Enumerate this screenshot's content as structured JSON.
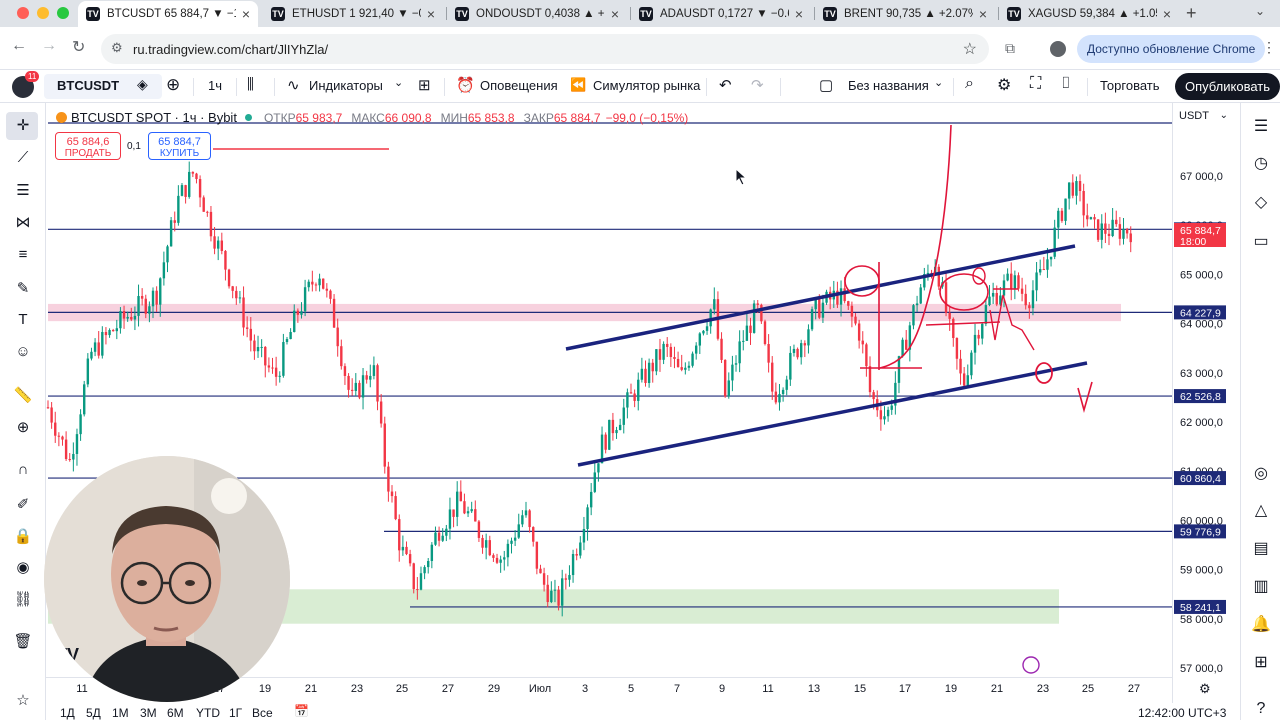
{
  "browser": {
    "tabs": [
      {
        "title": "BTCUSDT 65 884,7 ▼ −1,0…",
        "active": true
      },
      {
        "title": "ETHUSDT 1 921,40 ▼ −0.4…",
        "active": false
      },
      {
        "title": "ONDOUSDT 0,4038 ▲ +0…",
        "active": false
      },
      {
        "title": "ADAUSDT 0,1727 ▼ −0.6…",
        "active": false
      },
      {
        "title": "BRENT 90,735 ▲ +2.07%…",
        "active": false
      },
      {
        "title": "XAGUSD 59,384 ▲ +1.05…",
        "active": false
      }
    ],
    "url": "ru.tradingview.com/chart/JlIYhZla/",
    "update_label": "Доступно обновление Chrome"
  },
  "toolbar": {
    "notifications": "11",
    "symbol": "BTCUSDT",
    "interval": "1ч",
    "indicators": "Индикаторы",
    "alerts": "Оповещения",
    "replay": "Симулятор рынка",
    "layout_name": "Без названия",
    "trade": "Торговать",
    "publish": "Опубликовать"
  },
  "legend": {
    "title": "BTCUSDT SPOT · 1ч · Bybit",
    "open_label": "ОТКР",
    "open": "65 983,7",
    "high_label": "МАКС",
    "high": "66 090,8",
    "low_label": "МИН",
    "low": "65 853,8",
    "close_label": "ЗАКР",
    "close": "65 884,7",
    "change": "−99,0 (−0,15%)",
    "sell_price": "65 884,6",
    "sell_label": "ПРОДАТЬ",
    "spread": "0,1",
    "buy_price": "65 884,7",
    "buy_label": "КУПИТЬ"
  },
  "price_scale": {
    "currency": "USDT",
    "ticks": [
      "67 000,0",
      "66 000,0",
      "65 000,0",
      "64 000,0",
      "63 000,0",
      "62 000,0",
      "61 000,0",
      "60 000,0",
      "59 000,0",
      "58 000,0",
      "57 000,0"
    ],
    "badges": [
      {
        "value": "65 916,3",
        "color": "#1e2a78"
      },
      {
        "value": "65 884,7",
        "sub": "18:00",
        "color": "#f23645"
      },
      {
        "value": "64 227,9",
        "color": "#1e2a78"
      },
      {
        "value": "62 526,8",
        "color": "#1e2a78"
      },
      {
        "value": "60 860,4",
        "color": "#1e2a78"
      },
      {
        "value": "59 776,9",
        "color": "#1e2a78"
      },
      {
        "value": "58 241,1",
        "color": "#1e2a78"
      }
    ]
  },
  "time_scale": {
    "labels": [
      "11",
      "17",
      "19",
      "21",
      "23",
      "25",
      "27",
      "29",
      "Июл",
      "3",
      "5",
      "7",
      "9",
      "11",
      "13",
      "15",
      "17",
      "19",
      "21",
      "23",
      "25",
      "27"
    ]
  },
  "bottom_bar": {
    "ranges": [
      "1Д",
      "5Д",
      "1М",
      "3М",
      "6М",
      "YTD",
      "1Г",
      "Все"
    ],
    "clock": "12:42:00 UTC+3"
  },
  "chart_data": {
    "type": "candlestick",
    "symbol": "BTCUSDT",
    "ylim": [
      56700,
      67400
    ],
    "horizontal_levels": [
      65916.3,
      64227.9,
      62526.8,
      60860.4,
      59776.9,
      58241.1
    ],
    "path_points": [
      [
        0,
        62300
      ],
      [
        0.02,
        61200
      ],
      [
        0.04,
        63400
      ],
      [
        0.07,
        64100
      ],
      [
        0.1,
        64600
      ],
      [
        0.12,
        66500
      ],
      [
        0.135,
        67100
      ],
      [
        0.15,
        66000
      ],
      [
        0.17,
        64800
      ],
      [
        0.19,
        63500
      ],
      [
        0.21,
        62900
      ],
      [
        0.23,
        64200
      ],
      [
        0.25,
        65100
      ],
      [
        0.265,
        64000
      ],
      [
        0.28,
        62400
      ],
      [
        0.3,
        63200
      ],
      [
        0.31,
        61300
      ],
      [
        0.325,
        59500
      ],
      [
        0.34,
        58600
      ],
      [
        0.36,
        59800
      ],
      [
        0.38,
        60400
      ],
      [
        0.4,
        59700
      ],
      [
        0.42,
        59200
      ],
      [
        0.44,
        60200
      ],
      [
        0.455,
        58800
      ],
      [
        0.47,
        58300
      ],
      [
        0.49,
        59600
      ],
      [
        0.51,
        61500
      ],
      [
        0.53,
        62200
      ],
      [
        0.55,
        62900
      ],
      [
        0.57,
        63500
      ],
      [
        0.585,
        62900
      ],
      [
        0.6,
        63800
      ],
      [
        0.615,
        64400
      ],
      [
        0.625,
        62500
      ],
      [
        0.64,
        63600
      ],
      [
        0.655,
        64300
      ],
      [
        0.67,
        62500
      ],
      [
        0.69,
        63400
      ],
      [
        0.71,
        64300
      ],
      [
        0.73,
        64600
      ],
      [
        0.75,
        63800
      ],
      [
        0.76,
        62500
      ],
      [
        0.775,
        62100
      ],
      [
        0.79,
        63500
      ],
      [
        0.805,
        64700
      ],
      [
        0.82,
        65300
      ],
      [
        0.835,
        63600
      ],
      [
        0.845,
        62700
      ],
      [
        0.855,
        63700
      ],
      [
        0.87,
        64500
      ],
      [
        0.89,
        64900
      ],
      [
        0.905,
        64500
      ],
      [
        0.92,
        65100
      ],
      [
        0.935,
        66200
      ],
      [
        0.945,
        66900
      ],
      [
        0.955,
        66400
      ],
      [
        0.965,
        65900
      ]
    ]
  }
}
